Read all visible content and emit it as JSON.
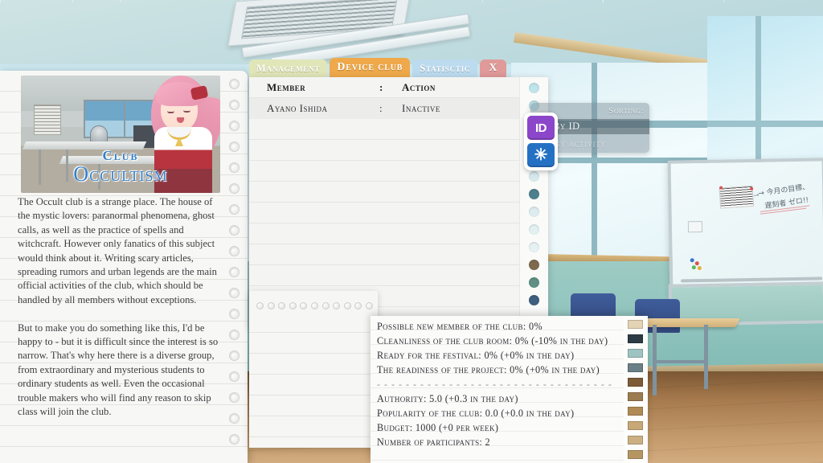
{
  "club_panel": {
    "logo_line1": "Club",
    "logo_line2": "Occultism",
    "description_p1": "The Occult club is a strange place. The house of the mystic lovers: paranormal phenomena, ghost calls, as well as the practice of spells and witchcraft. However only fanatics of this subject would think about it. Writing scary articles, spreading rumors and urban legends are the main official activities of the club, which should be handled by all members without exceptions.",
    "description_p2": "But to make you do something like this, I'd be happy to - but it is difficult since the interest is so narrow. That's why here there is a diverse group, from extraordinary and mysterious students to ordinary students as well. Even the occasional trouble makers who will find any reason to skip class will join the club."
  },
  "tabs": [
    {
      "id": "management",
      "label": "Management",
      "color": "#e0e6b8",
      "active": false
    },
    {
      "id": "device-club",
      "label": "Device club",
      "color": "#efa94a",
      "active": true
    },
    {
      "id": "statisctic",
      "label": "Statisctic",
      "color": "#bcdbef",
      "active": false
    },
    {
      "id": "close",
      "label": "X",
      "color": "#e09a9a",
      "active": false
    }
  ],
  "member_table": {
    "columns": {
      "member": "Member",
      "separator": ":",
      "action": "Action"
    },
    "rows": [
      {
        "member": "Ayano Ishida",
        "separator": ":",
        "action": "Inactive"
      }
    ],
    "status_dots": [
      "#bfe4ea",
      "#bfe4ea",
      "#d8ecef",
      "#cfe6ea",
      "#dceef1",
      "#d6eaee",
      "#4e7f8c",
      "#dcecef",
      "#e2f0f2",
      "#e6f1f3",
      "#7d6a4e",
      "#5f8f85",
      "#3e5f7e"
    ]
  },
  "sorting": {
    "title": "Sorting:",
    "options": [
      {
        "id": "by-id",
        "label": "By ID",
        "icon": "ID",
        "icon_name": "id-icon",
        "icon_color": "#8b46c9",
        "active": true
      },
      {
        "id": "by-activity",
        "label": "By activity",
        "icon": "✳",
        "icon_name": "asterisk-icon",
        "icon_color": "#2471c4",
        "active": false
      }
    ]
  },
  "stats": {
    "lines_top": [
      "Possible new member of the club: 0%",
      "Cleanliness of the club room: 0% (-10% in the day)",
      "Ready for the festival: 0% (+0% in the day)",
      "The readiness of the project: 0% (+0% in the day)"
    ],
    "separator": "- - - - - - - - - - - - - - - - - - - - - - - - - - - - - - - - -",
    "lines_bottom": [
      "Authority: 5.0 (+0.3 in the day)",
      "Popularity of the club: 0.0 (+0.0 in the day)",
      "Budget: 1000 (+0 per week)",
      "Number of participants: 2"
    ],
    "swatches": [
      "#e4d3b4",
      "#2c3a44",
      "#9ec4c2",
      "#6a7f86",
      "#7d5b37",
      "#9c7b50",
      "#b08a54",
      "#c8a877",
      "#cbb083",
      "#b59562"
    ]
  },
  "notepad": {
    "content": ""
  },
  "background": {
    "whiteboard_note_line1": "→ 今月の目標、",
    "whiteboard_note_line2": "遅刻者 ゼロ!!"
  }
}
